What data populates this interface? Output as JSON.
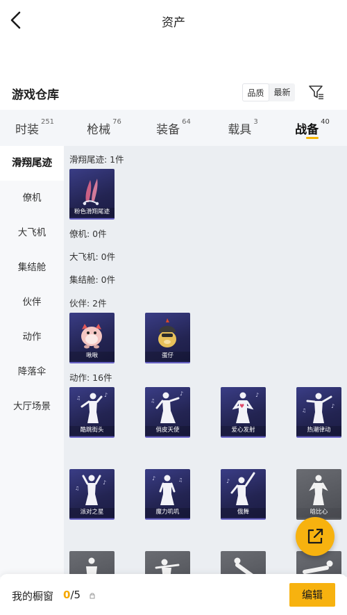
{
  "header": {
    "title": "资产"
  },
  "warehouse": {
    "title": "游戏仓库",
    "sort_options": [
      "品质",
      "最新"
    ]
  },
  "tabs": [
    {
      "label": "时装",
      "count": "251"
    },
    {
      "label": "枪械",
      "count": "76"
    },
    {
      "label": "装备",
      "count": "64"
    },
    {
      "label": "载具",
      "count": "3"
    },
    {
      "label": "战备",
      "count": "40",
      "active": true
    }
  ],
  "sidebar": {
    "items": [
      {
        "label": "滑翔尾迹",
        "active": true
      },
      {
        "label": "僚机"
      },
      {
        "label": "大飞机"
      },
      {
        "label": "集结舱"
      },
      {
        "label": "伙伴"
      },
      {
        "label": "动作"
      },
      {
        "label": "降落伞"
      },
      {
        "label": "大厅场景"
      }
    ]
  },
  "sections": {
    "glide_trail": {
      "label": "滑翔尾迹: 1件",
      "items": [
        "粉色滑翔尾迹"
      ]
    },
    "wingman": {
      "label": "僚机: 0件"
    },
    "big_plane": {
      "label": "大飞机: 0件"
    },
    "assembly_pod": {
      "label": "集结舱: 0件"
    },
    "partner": {
      "label": "伙伴: 2件",
      "items": [
        "啾啾",
        "蛋仔"
      ]
    },
    "emote": {
      "label": "动作: 16件",
      "items": [
        "酷跳街头",
        "俏皮天使",
        "爱心发射",
        "热潮律动",
        "派对之星",
        "魔力叽叽",
        "俄舞",
        "晗比心"
      ]
    }
  },
  "bottom": {
    "label": "我的橱窗",
    "count_current": "0",
    "count_total": "/5",
    "edit_label": "编辑"
  },
  "colors": {
    "accent": "#f7b20f",
    "card_dark": "#2a2b5e",
    "card_gray": "#5a5c62"
  },
  "icons": [
    "back-arrow-icon",
    "filter-icon",
    "share-icon",
    "lock-icon"
  ]
}
